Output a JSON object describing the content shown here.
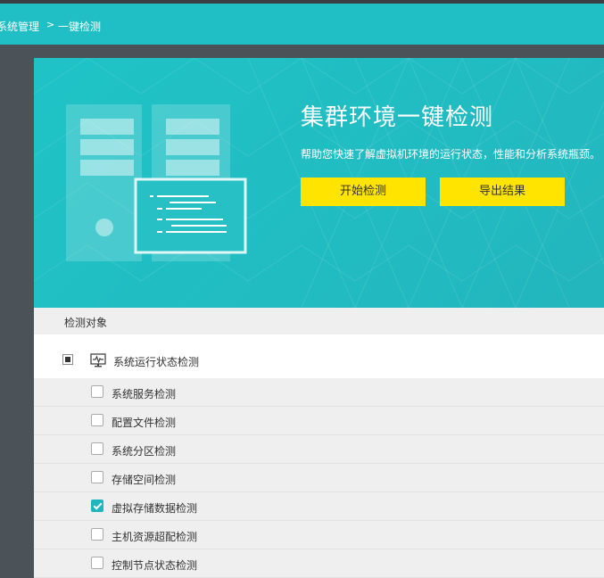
{
  "nav": {
    "breadcrumb_parent": "系统管理",
    "breadcrumb_sep": ">",
    "breadcrumb_current": "一键检测"
  },
  "hero": {
    "title": "集群环境一键检测",
    "description": "帮助您快速了解虚拟机环境的运行状态，性能和分析系统瓶颈。",
    "start_button": "开始检测",
    "export_button": "导出结果"
  },
  "section": {
    "header": "检测对象"
  },
  "group": {
    "label": "系统运行状态检测",
    "icon": "monitor-pulse-icon",
    "state": "partial"
  },
  "items": [
    {
      "label": "系统服务检测",
      "checked": false
    },
    {
      "label": "配置文件检测",
      "checked": false
    },
    {
      "label": "系统分区检测",
      "checked": false
    },
    {
      "label": "存储空间检测",
      "checked": false
    },
    {
      "label": "虚拟存储数据检测",
      "checked": true
    },
    {
      "label": "主机资源超配检测",
      "checked": false
    },
    {
      "label": "控制节点状态检测",
      "checked": false
    }
  ],
  "colors": {
    "accent": "#1fbfc5",
    "button": "#ffe400",
    "checked": "#1fb7bd"
  }
}
